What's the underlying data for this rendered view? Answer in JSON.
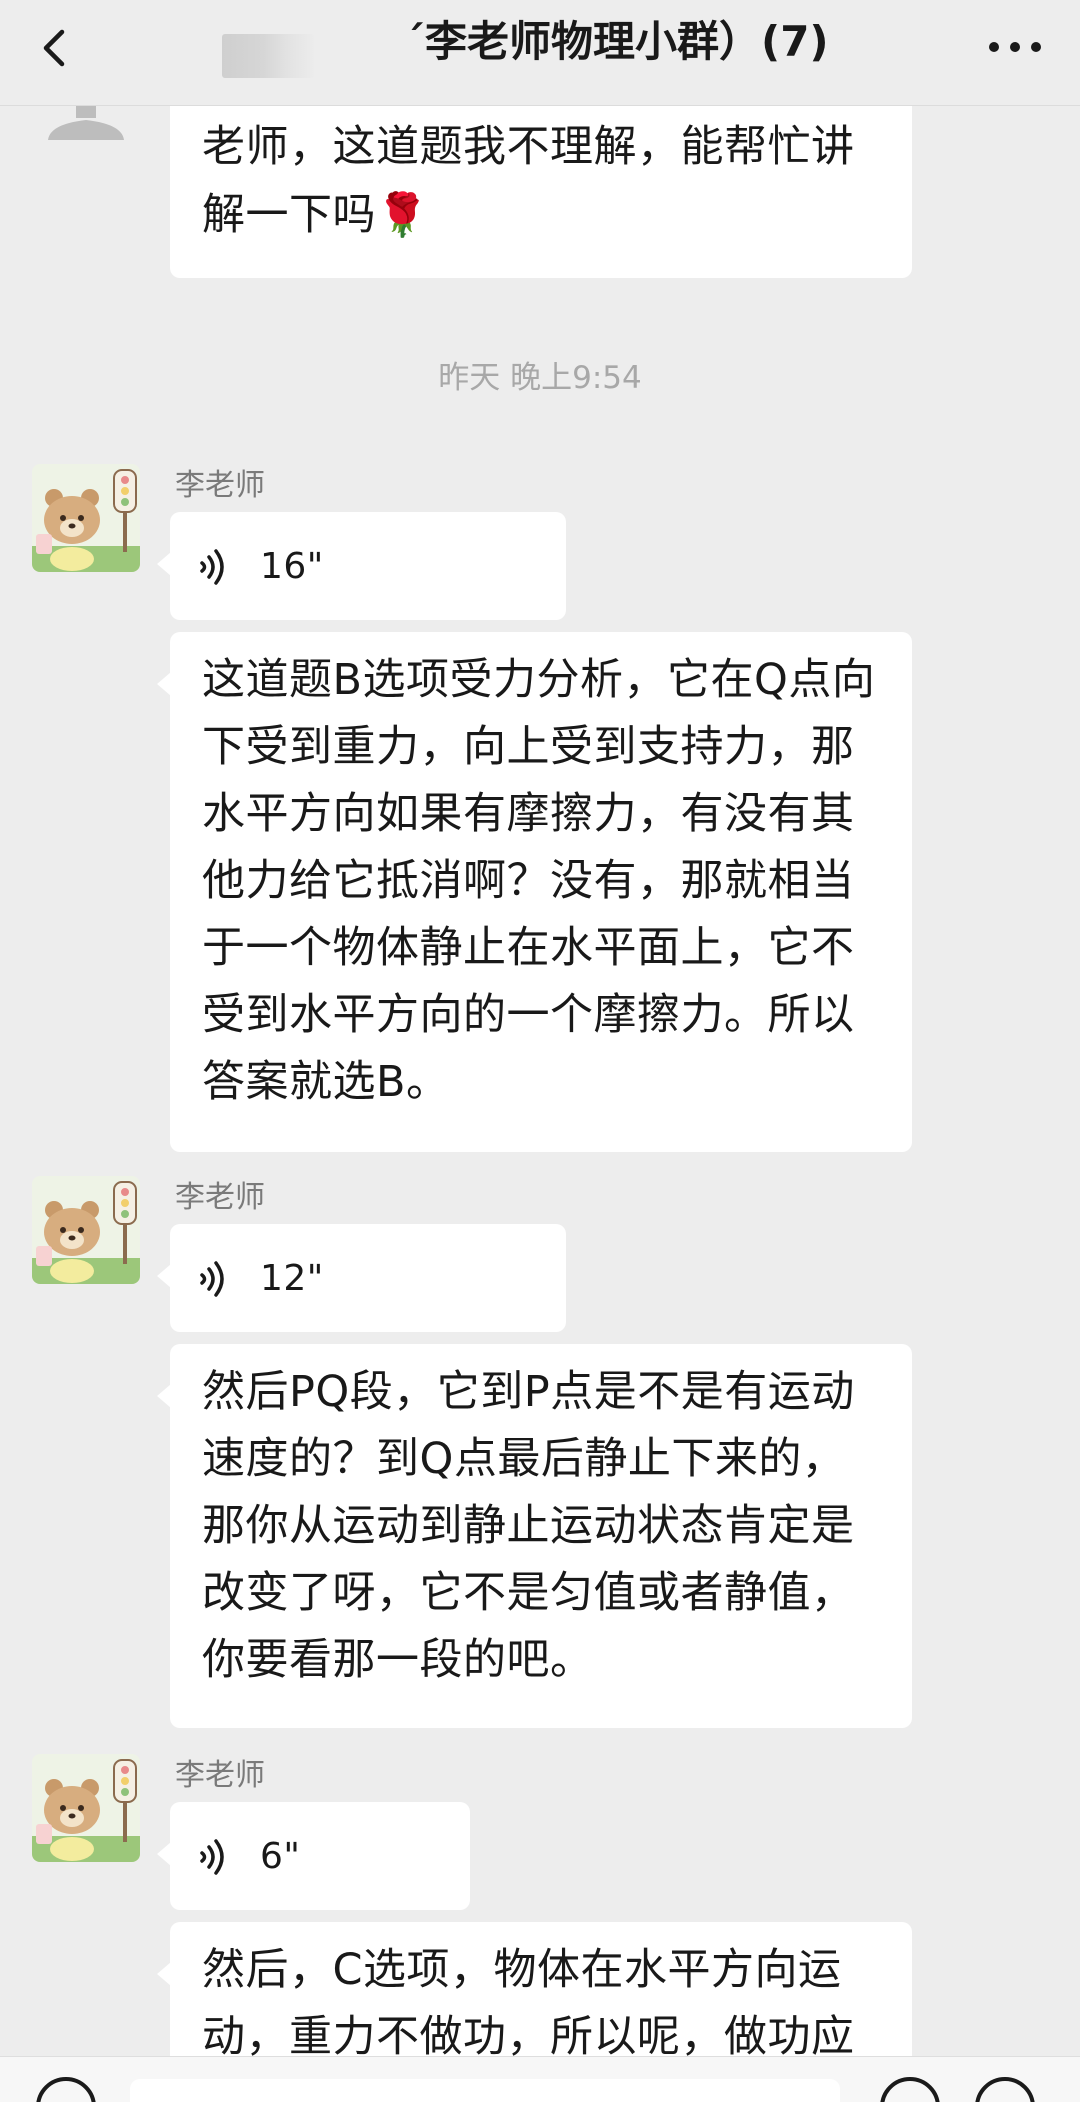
{
  "header": {
    "title": "´李老师物理小群）(7)"
  },
  "messages": {
    "m0": {
      "text": "老师，这道题我不理解，能帮忙讲解一下吗",
      "emoji": "🌹"
    },
    "timestamp": "昨天 晚上9:54",
    "m1_sender": "李老师",
    "m1_voice": "16\"",
    "m1_text": "这道题B选项受力分析，它在Q点向下受到重力，向上受到支持力，那水平方向如果有摩擦力，有没有其他力给它抵消啊？没有，那就相当于一个物体静止在水平面上，它不受到水平方向的一个摩擦力。所以答案就选B。",
    "m2_sender": "李老师",
    "m2_voice": "12\"",
    "m2_text": "然后PQ段，它到P点是不是有运动速度的？到Q点最后静止下来的，那你从运动到静止运动状态肯定是改变了呀，它不是匀值或者静值，你要看那一段的吧。",
    "m3_sender": "李老师",
    "m3_voice": "6\"",
    "m3_text": "然后，C选项，物体在水平方向运动，重力不做功，所以呢，做功应"
  },
  "icons": {
    "back": "chevron-left-icon",
    "more": "more-dots-icon",
    "voice": "voice-wave-icon",
    "avatar": "bear-traffic-light-avatar",
    "rose": "rose-emoji"
  },
  "colors": {
    "background": "#ededed",
    "bubble": "#ffffff",
    "text": "#191919",
    "meta": "#a8a8a8"
  }
}
